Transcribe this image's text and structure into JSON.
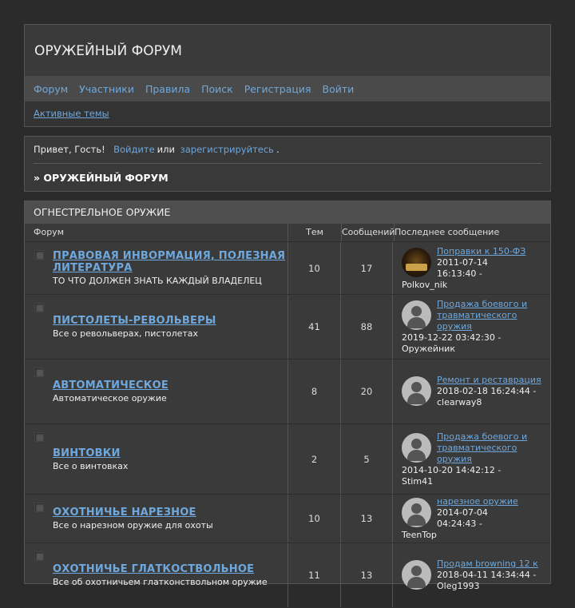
{
  "site": {
    "title": "ОРУЖЕЙНЫЙ ФОРУМ"
  },
  "nav": [
    "Форум",
    "Участники",
    "Правила",
    "Поиск",
    "Регистрация",
    "Войти"
  ],
  "subnav": {
    "active_topics": "Активные темы"
  },
  "greeting": {
    "hello": "Привет, Гость!",
    "login": "Войдите",
    "or": "или",
    "register": "зарегистрируйтесь",
    "dot": ".",
    "breadcrumb": "» ОРУЖЕЙНЫЙ ФОРУМ"
  },
  "category": {
    "title": "ОГНЕСТРЕЛЬНОЕ ОРУЖИЕ",
    "columns": {
      "forum": "Форум",
      "topics": "Тем",
      "posts": "Сообщений",
      "last": "Последнее сообщение"
    }
  },
  "forums": [
    {
      "name": "ПРАВОВАЯ ИНВОРМАЦИЯ, ПОЛЕЗНАЯ ЛИТЕРАТУРА",
      "desc": "ТО ЧТО ДОЛЖЕН ЗНАТЬ КАЖДЫЙ ВЛАДЕЛЕЦ",
      "topics": "10",
      "posts": "17",
      "last_title": "Поправки к 150-ФЗ",
      "last_time": "2011-07-14 16:13:40 -",
      "last_user": "Polkov_nik",
      "avatar": "image"
    },
    {
      "name": "ПИСТОЛЕТЫ-РЕВОЛЬВЕРЫ",
      "desc": "Все о револьверах, пистолетах",
      "topics": "41",
      "posts": "88",
      "last_title": "Продажа боевого и травматического оружия",
      "last_time": "2019-12-22 03:42:30 -",
      "last_user": "Оружейник",
      "avatar": "default"
    },
    {
      "name": "АВТОМАТИЧЕСКОЕ",
      "desc": "Автоматическое оружие",
      "topics": "8",
      "posts": "20",
      "last_title": "Ремонт и реставрация",
      "last_time": "2018-02-18 16:24:44 -",
      "last_user": "clearway8",
      "avatar": "default"
    },
    {
      "name": "ВИНТОВКИ",
      "desc": "Все о винтовках",
      "topics": "2",
      "posts": "5",
      "last_title": "Продажа боевого и травматического оружия",
      "last_time": "2014-10-20 14:42:12 -",
      "last_user": "Stim41",
      "avatar": "default"
    },
    {
      "name": "ОХОТНИЧЬЕ НАРЕЗНОЕ",
      "desc": "Все о нарезном оружие для охоты",
      "topics": "10",
      "posts": "13",
      "last_title": "нарезное оружие",
      "last_time": "2014-07-04 04:24:43 -",
      "last_user": "TeenTop",
      "avatar": "default"
    },
    {
      "name": "ОХОТНИЧЬЕ ГЛАТКОСТВОЛЬНОЕ",
      "desc": "Все об охотничьем глатконствольном оружие",
      "topics": "11",
      "posts": "13",
      "last_title": "Продам browning 12 к",
      "last_time": "2018-04-11 14:34:44 -",
      "last_user": "Oleg1993",
      "avatar": "default"
    }
  ]
}
